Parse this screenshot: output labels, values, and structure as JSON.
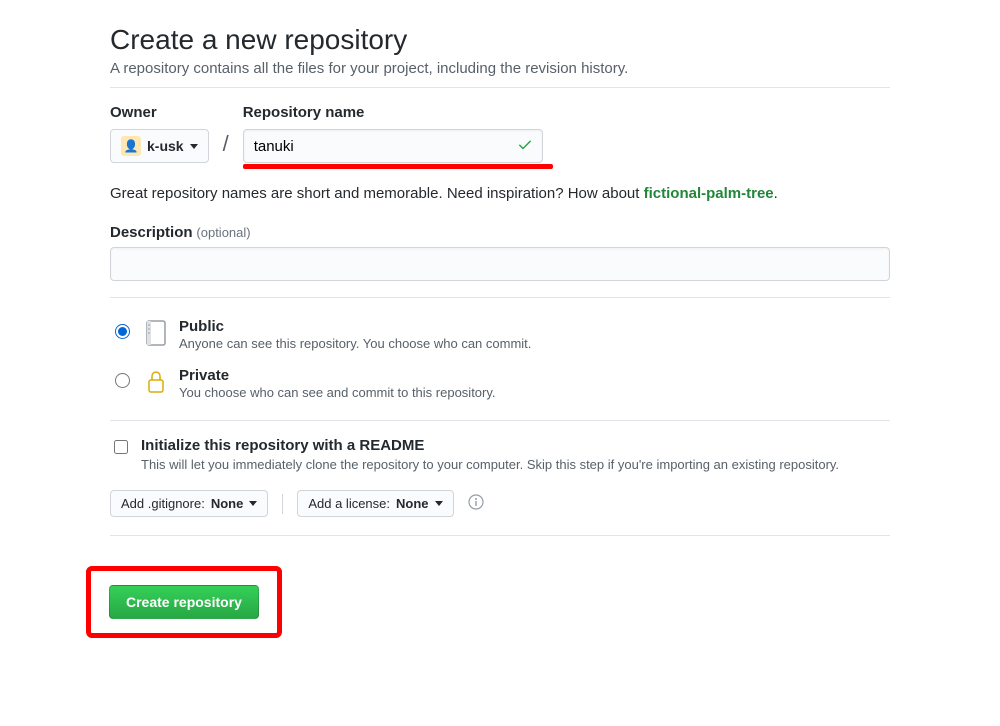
{
  "header": {
    "title": "Create a new repository",
    "subtitle": "A repository contains all the files for your project, including the revision history."
  },
  "owner": {
    "label": "Owner",
    "username": "k-usk"
  },
  "repo": {
    "label": "Repository name",
    "value": "tanuki"
  },
  "hint": {
    "prefix": "Great repository names are short and memorable. Need inspiration? How about ",
    "suggestion": "fictional-palm-tree",
    "suffix": "."
  },
  "description": {
    "label": "Description",
    "optional": "(optional)",
    "value": ""
  },
  "visibility": {
    "public": {
      "title": "Public",
      "sub": "Anyone can see this repository. You choose who can commit."
    },
    "private": {
      "title": "Private",
      "sub": "You choose who can see and commit to this repository."
    }
  },
  "initialize": {
    "title": "Initialize this repository with a README",
    "sub": "This will let you immediately clone the repository to your computer. Skip this step if you're importing an existing repository."
  },
  "gitignore": {
    "prefix": "Add .gitignore: ",
    "value": "None"
  },
  "license": {
    "prefix": "Add a license: ",
    "value": "None"
  },
  "submit": {
    "label": "Create repository"
  }
}
